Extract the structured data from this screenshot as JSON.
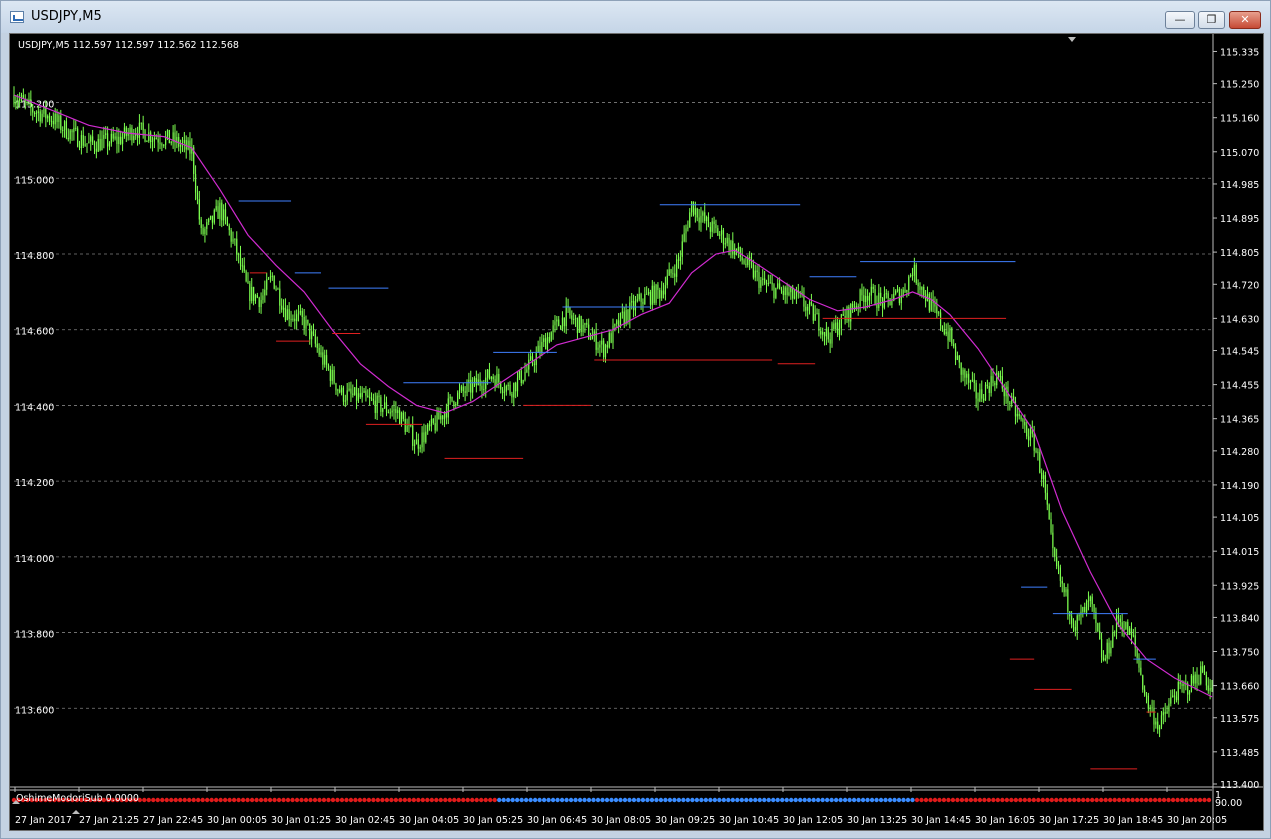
{
  "window": {
    "title": "USDJPY,M5",
    "minimize_icon": "minimize-icon",
    "maximize_icon": "maximize-icon",
    "close_icon": "close-icon"
  },
  "chart_info": "USDJPY,M5  112.597 112.597 112.562 112.568",
  "colors": {
    "background": "#000000",
    "candle": "#7cff4f",
    "ma": "#d02bd0",
    "high_line": "#3f7fff",
    "low_line": "#e02020",
    "grid": "#808080"
  },
  "chart_data": {
    "type": "candlestick",
    "title": "USDJPY,M5",
    "ylim": [
      113.4,
      115.36
    ],
    "left_labels": [
      "115.200",
      "115.000",
      "114.800",
      "114.600",
      "114.400",
      "114.200",
      "114.000",
      "113.800",
      "113.600"
    ],
    "right_labels": [
      "115.335",
      "115.250",
      "115.160",
      "115.070",
      "114.985",
      "114.895",
      "114.805",
      "114.720",
      "114.630",
      "114.545",
      "114.455",
      "114.365",
      "114.280",
      "114.190",
      "114.105",
      "114.015",
      "113.925",
      "113.840",
      "113.750",
      "113.660",
      "113.575",
      "113.485",
      "113.400"
    ],
    "x_labels": [
      "27 Jan 2017",
      "27 Jan 21:25",
      "27 Jan 22:45",
      "30 Jan 00:05",
      "30 Jan 01:25",
      "30 Jan 02:45",
      "30 Jan 04:05",
      "30 Jan 05:25",
      "30 Jan 06:45",
      "30 Jan 08:05",
      "30 Jan 09:25",
      "30 Jan 10:45",
      "30 Jan 12:05",
      "30 Jan 13:25",
      "30 Jan 14:45",
      "30 Jan 16:05",
      "30 Jan 17:25",
      "30 Jan 18:45",
      "30 Jan 20:05"
    ],
    "close_path": [
      [
        0,
        115.22
      ],
      [
        10,
        115.18
      ],
      [
        20,
        115.16
      ],
      [
        30,
        115.12
      ],
      [
        40,
        115.09
      ],
      [
        55,
        115.1
      ],
      [
        65,
        115.13
      ],
      [
        75,
        115.11
      ],
      [
        85,
        115.1
      ],
      [
        95,
        115.07
      ],
      [
        100,
        114.85
      ],
      [
        105,
        114.88
      ],
      [
        110,
        114.92
      ],
      [
        118,
        114.82
      ],
      [
        125,
        114.7
      ],
      [
        132,
        114.68
      ],
      [
        138,
        114.74
      ],
      [
        145,
        114.65
      ],
      [
        155,
        114.62
      ],
      [
        165,
        114.52
      ],
      [
        175,
        114.43
      ],
      [
        185,
        114.42
      ],
      [
        195,
        114.4
      ],
      [
        205,
        114.38
      ],
      [
        215,
        114.3
      ],
      [
        225,
        114.35
      ],
      [
        235,
        114.42
      ],
      [
        245,
        114.45
      ],
      [
        255,
        114.48
      ],
      [
        265,
        114.44
      ],
      [
        275,
        114.5
      ],
      [
        285,
        114.58
      ],
      [
        295,
        114.64
      ],
      [
        305,
        114.6
      ],
      [
        315,
        114.55
      ],
      [
        325,
        114.63
      ],
      [
        335,
        114.68
      ],
      [
        345,
        114.7
      ],
      [
        355,
        114.78
      ],
      [
        362,
        114.93
      ],
      [
        370,
        114.88
      ],
      [
        380,
        114.84
      ],
      [
        390,
        114.78
      ],
      [
        400,
        114.72
      ],
      [
        410,
        114.7
      ],
      [
        420,
        114.68
      ],
      [
        430,
        114.62
      ],
      [
        435,
        114.58
      ],
      [
        445,
        114.64
      ],
      [
        455,
        114.7
      ],
      [
        465,
        114.67
      ],
      [
        475,
        114.7
      ],
      [
        480,
        114.76
      ],
      [
        490,
        114.66
      ],
      [
        500,
        114.58
      ],
      [
        505,
        114.5
      ],
      [
        515,
        114.42
      ],
      [
        525,
        114.48
      ],
      [
        535,
        114.38
      ],
      [
        545,
        114.3
      ],
      [
        550,
        114.2
      ],
      [
        555,
        114.0
      ],
      [
        560,
        113.92
      ],
      [
        567,
        113.82
      ],
      [
        575,
        113.88
      ],
      [
        582,
        113.72
      ],
      [
        590,
        113.84
      ],
      [
        598,
        113.78
      ],
      [
        605,
        113.62
      ],
      [
        612,
        113.55
      ],
      [
        620,
        113.64
      ],
      [
        628,
        113.66
      ],
      [
        635,
        113.7
      ],
      [
        640,
        113.64
      ]
    ],
    "ma_path": [
      [
        0,
        115.22
      ],
      [
        20,
        115.18
      ],
      [
        40,
        115.14
      ],
      [
        60,
        115.12
      ],
      [
        80,
        115.11
      ],
      [
        95,
        115.08
      ],
      [
        110,
        114.97
      ],
      [
        125,
        114.85
      ],
      [
        140,
        114.77
      ],
      [
        155,
        114.7
      ],
      [
        170,
        114.6
      ],
      [
        185,
        114.51
      ],
      [
        200,
        114.45
      ],
      [
        215,
        114.4
      ],
      [
        230,
        114.38
      ],
      [
        245,
        114.41
      ],
      [
        260,
        114.46
      ],
      [
        275,
        114.51
      ],
      [
        290,
        114.56
      ],
      [
        305,
        114.58
      ],
      [
        320,
        114.6
      ],
      [
        335,
        114.64
      ],
      [
        350,
        114.67
      ],
      [
        362,
        114.75
      ],
      [
        375,
        114.8
      ],
      [
        385,
        114.81
      ],
      [
        395,
        114.78
      ],
      [
        410,
        114.73
      ],
      [
        425,
        114.68
      ],
      [
        440,
        114.65
      ],
      [
        455,
        114.66
      ],
      [
        470,
        114.68
      ],
      [
        480,
        114.7
      ],
      [
        490,
        114.68
      ],
      [
        500,
        114.64
      ],
      [
        515,
        114.55
      ],
      [
        530,
        114.44
      ],
      [
        545,
        114.33
      ],
      [
        560,
        114.12
      ],
      [
        575,
        113.96
      ],
      [
        590,
        113.82
      ],
      [
        605,
        113.73
      ],
      [
        620,
        113.68
      ],
      [
        640,
        113.63
      ]
    ],
    "high_lines": [
      [
        120,
        114.94,
        148
      ],
      [
        150,
        114.75,
        164
      ],
      [
        168,
        114.71,
        200
      ],
      [
        208,
        114.46,
        255
      ],
      [
        256,
        114.54,
        290
      ],
      [
        293,
        114.66,
        340
      ],
      [
        345,
        114.93,
        420
      ],
      [
        425,
        114.74,
        450
      ],
      [
        452,
        114.78,
        535
      ],
      [
        538,
        113.92,
        552
      ],
      [
        555,
        113.85,
        595
      ],
      [
        598,
        113.73,
        610
      ]
    ],
    "low_lines": [
      [
        126,
        114.75,
        135
      ],
      [
        140,
        114.57,
        158
      ],
      [
        170,
        114.59,
        185
      ],
      [
        188,
        114.35,
        218
      ],
      [
        230,
        114.26,
        272
      ],
      [
        272,
        114.4,
        308
      ],
      [
        310,
        114.52,
        405
      ],
      [
        408,
        114.51,
        428
      ],
      [
        432,
        114.63,
        530
      ],
      [
        532,
        113.73,
        545
      ],
      [
        545,
        113.65,
        565
      ],
      [
        575,
        113.44,
        600
      ],
      [
        605,
        113.59,
        610
      ]
    ]
  },
  "subwindow": {
    "label": "OshimeModoriSub 0.0000",
    "scale_top": "1",
    "scale_bottom": "0.00",
    "scale_mid": "9"
  }
}
